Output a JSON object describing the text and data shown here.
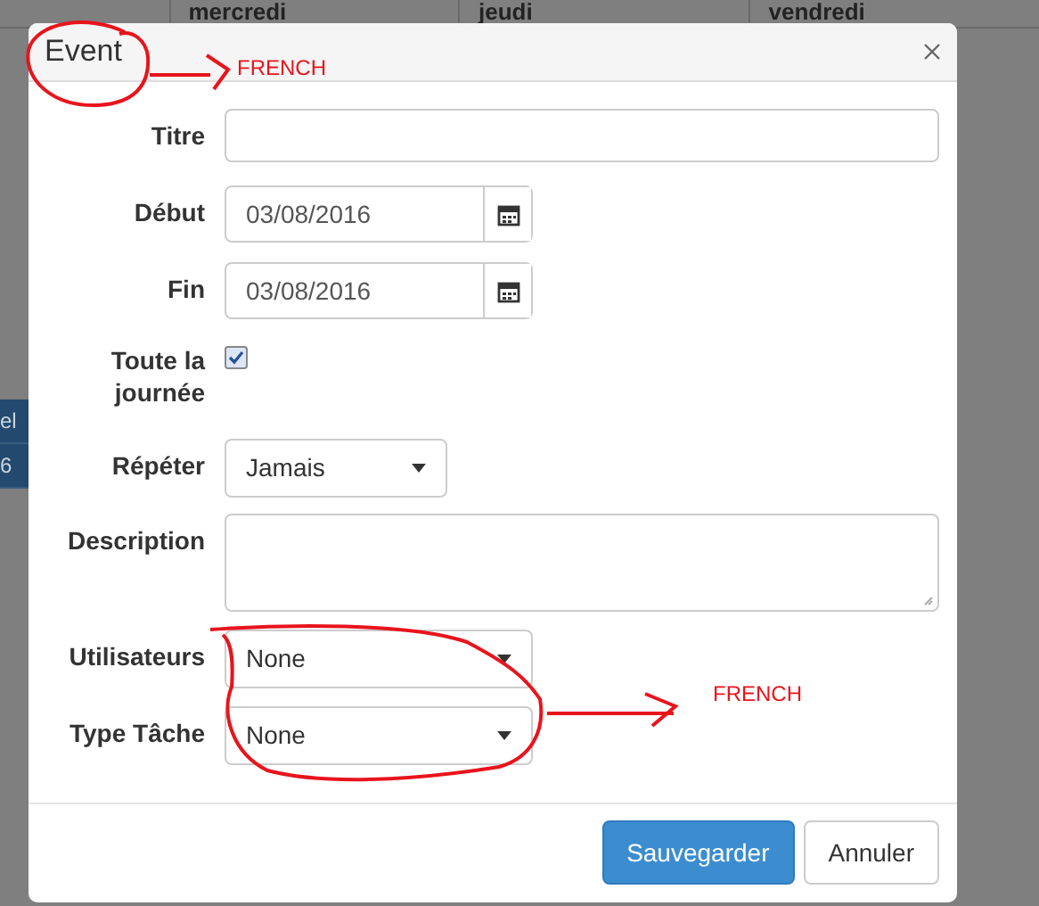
{
  "calendar": {
    "day_headers": [
      "mercredi",
      "jeudi",
      "vendredi"
    ],
    "event_fragments": [
      "el",
      "6"
    ]
  },
  "modal": {
    "title": "Event",
    "fields": [
      {
        "kind": "text",
        "label": "Titre"
      },
      {
        "kind": "date",
        "label": "Début",
        "value": "03/08/2016"
      },
      {
        "kind": "date",
        "label": "Fin",
        "value": "03/08/2016"
      },
      {
        "kind": "checkbox",
        "label": "Toute la journée",
        "checked": true
      },
      {
        "kind": "select",
        "label": "Répéter",
        "value": "Jamais"
      },
      {
        "kind": "textarea",
        "label": "Description"
      },
      {
        "kind": "select",
        "label": "Utilisateurs",
        "value": "None"
      },
      {
        "kind": "select",
        "label": "Type Tâche",
        "value": "None"
      }
    ],
    "buttons": [
      {
        "label": "Sauvegarder",
        "kind": "primary"
      },
      {
        "label": "Annuler",
        "kind": "default"
      }
    ]
  },
  "annotations": [
    "FRENCH",
    "FRENCH"
  ]
}
